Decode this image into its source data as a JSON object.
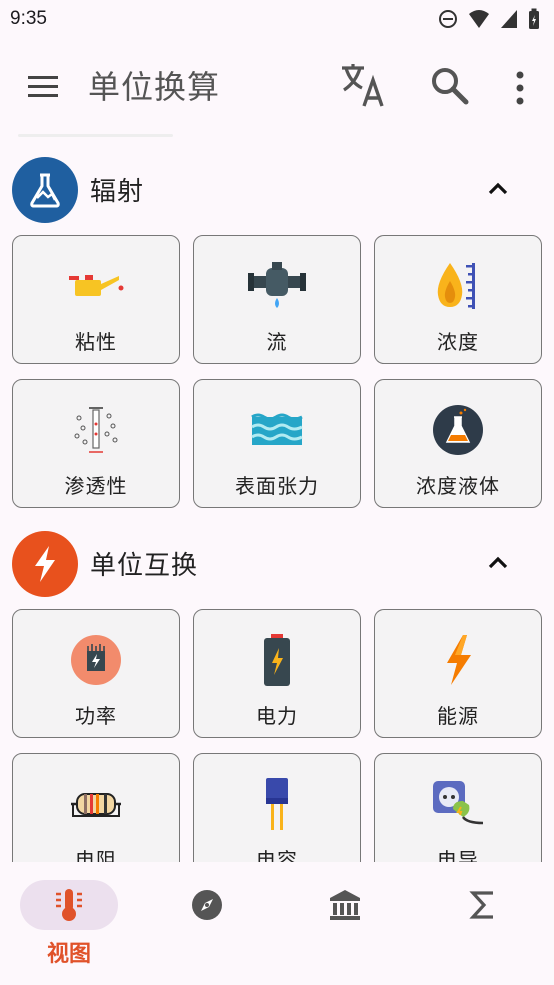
{
  "status": {
    "time": "9:35"
  },
  "appbar": {
    "title": "单位换算"
  },
  "sections": [
    {
      "label": "辐射",
      "color": "#1f5fa0",
      "icon": "flask-icon",
      "tiles": [
        {
          "label": "粘性",
          "icon": "oil-can-icon"
        },
        {
          "label": "流",
          "icon": "water-valve-icon"
        },
        {
          "label": "浓度",
          "icon": "drop-gauge-icon"
        },
        {
          "label": "渗透性",
          "icon": "membrane-icon"
        },
        {
          "label": "表面张力",
          "icon": "waves-icon"
        },
        {
          "label": "浓度液体",
          "icon": "beaker-icon"
        }
      ]
    },
    {
      "label": "单位互换",
      "color": "#e8511d",
      "icon": "lightning-icon",
      "tiles": [
        {
          "label": "功率",
          "icon": "power-tower-icon"
        },
        {
          "label": "电力",
          "icon": "battery-icon"
        },
        {
          "label": "能源",
          "icon": "bolt-icon"
        },
        {
          "label": "电阻",
          "icon": "resistor-icon"
        },
        {
          "label": "电容",
          "icon": "capacitor-icon"
        },
        {
          "label": "电导",
          "icon": "plug-socket-icon"
        }
      ]
    }
  ],
  "bottomnav": {
    "items": [
      {
        "label": "视图",
        "icon": "thermometer-icon",
        "active": true
      },
      {
        "label": "",
        "icon": "compass-icon"
      },
      {
        "label": "",
        "icon": "bank-icon"
      },
      {
        "label": "",
        "icon": "sigma-icon"
      }
    ]
  }
}
